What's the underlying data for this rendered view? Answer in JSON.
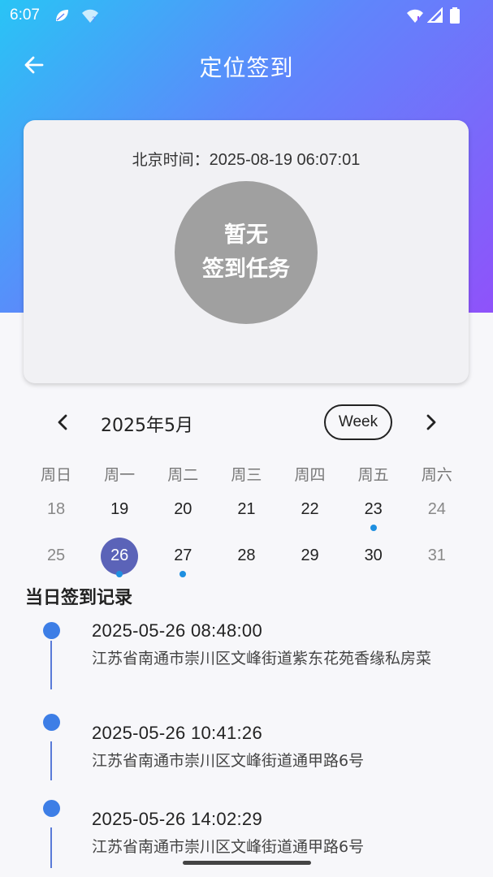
{
  "status_bar": {
    "time": "6:07",
    "icons": [
      "leaf-icon",
      "wifi-question-icon",
      "wifi-icon",
      "signal-icon",
      "battery-icon"
    ]
  },
  "app_bar": {
    "title": "定位签到",
    "back_icon": "arrow-left-icon"
  },
  "card": {
    "time_label": "北京时间：",
    "time_value": "2025-08-19 06:07:01",
    "circle_line1": "暂无",
    "circle_line2": "签到任务"
  },
  "calendar": {
    "month_label": "2025年5月",
    "view_toggle": "Week",
    "weekdays": [
      "周日",
      "周一",
      "周二",
      "周三",
      "周四",
      "周五",
      "周六"
    ],
    "weeks": [
      [
        "18",
        "19",
        "20",
        "21",
        "22",
        "23",
        "24"
      ],
      [
        "25",
        "26",
        "27",
        "28",
        "29",
        "30",
        "31"
      ]
    ],
    "selected_day": "26",
    "days_with_records": [
      "23",
      "26",
      "27"
    ]
  },
  "records": {
    "title": "当日签到记录",
    "items": [
      {
        "time": "2025-05-26 08:48:00",
        "address": "江苏省南通市崇川区文峰街道紫东花苑香缘私房菜"
      },
      {
        "time": "2025-05-26 10:41:26",
        "address": "江苏省南通市崇川区文峰街道通甲路6号"
      },
      {
        "time": "2025-05-26 14:02:29",
        "address": "江苏省南通市崇川区文峰街道通甲路6号"
      }
    ]
  },
  "colors": {
    "gradient_start": "#29c4f5",
    "gradient_end": "#8f52fa",
    "selected_day": "#5b63b8",
    "record_dot": "#3d7ee6",
    "event_dot": "#1e8fe0"
  }
}
